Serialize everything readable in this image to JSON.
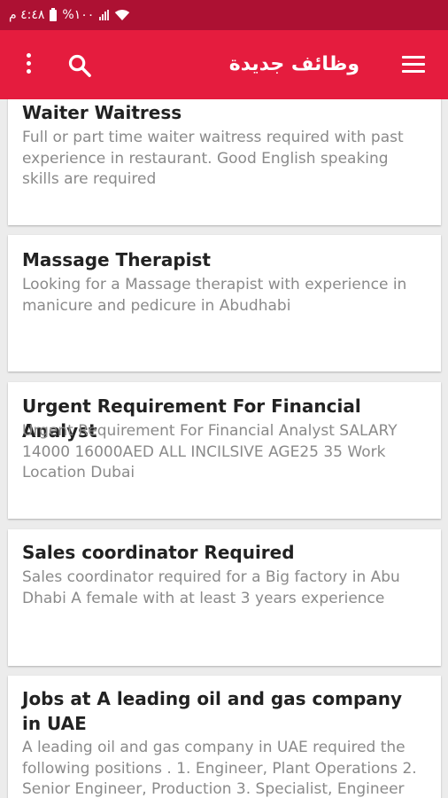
{
  "status_bar": {
    "time": "٤:٤٨ م",
    "battery": "%١٠٠"
  },
  "app_bar": {
    "title": "وظائف جديدة",
    "icons": {
      "menu": "menu-icon",
      "search": "search-icon",
      "more": "more-vert-icon"
    }
  },
  "colors": {
    "status_bar": "#ad1133",
    "app_bar": "#e51c3e",
    "background": "#ececec",
    "card": "#ffffff",
    "title_text": "#222222",
    "desc_text": "#8a8a8a"
  },
  "jobs": [
    {
      "title": "Waiter Waitress",
      "description": "Full or part time waiter waitress required with past experience in restaurant. Good English speaking skills are required"
    },
    {
      "title": "Massage Therapist",
      "description": "Looking for a Massage therapist with experience in manicure and pedicure in Abudhabi"
    },
    {
      "title": "Urgent Requirement For Financial Analyst",
      "description": "Urgent Requirement For Financial Analyst SALARY 14000 16000AED ALL INCILSIVE AGE25 35 Work Location Dubai"
    },
    {
      "title": "Sales coordinator Required",
      "description": "Sales coordinator required for a Big factory in Abu Dhabi A female with at least 3 years experience"
    },
    {
      "title": "Jobs at A leading oil and gas company in UAE",
      "description": "A leading oil and gas company in UAE required the following positions . 1. Engineer, Plant Operations 2. Senior Engineer, Production 3. Specialist, Engineer"
    }
  ]
}
